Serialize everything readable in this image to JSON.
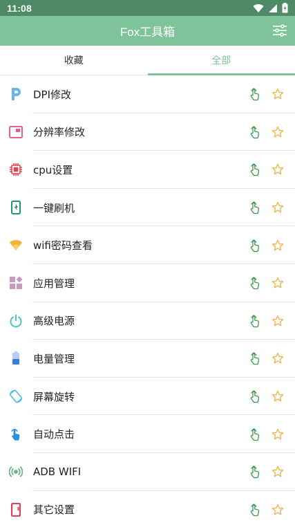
{
  "status_bar": {
    "time": "11:08"
  },
  "app_bar": {
    "title": "Fox工具箱"
  },
  "tabs": [
    {
      "label": "收藏",
      "active": false
    },
    {
      "label": "全部",
      "active": true
    }
  ],
  "colors": {
    "accent": "#7fc39a",
    "status_bar": "#4e8a66",
    "touch_icon": "#3b9a4c",
    "star_icon": "#f0b54a"
  },
  "items": [
    {
      "label": "DPI修改",
      "icon": "dpi-p-icon"
    },
    {
      "label": "分辨率修改",
      "icon": "resolution-icon"
    },
    {
      "label": "cpu设置",
      "icon": "cpu-chip-icon"
    },
    {
      "label": "一键刷机",
      "icon": "phone-flash-icon"
    },
    {
      "label": "wifi密码查看",
      "icon": "wifi-icon"
    },
    {
      "label": "应用管理",
      "icon": "apps-grid-icon"
    },
    {
      "label": "高级电源",
      "icon": "power-icon"
    },
    {
      "label": "电量管理",
      "icon": "battery-icon"
    },
    {
      "label": "屏幕旋转",
      "icon": "screen-rotation-icon"
    },
    {
      "label": "自动点击",
      "icon": "auto-tap-icon"
    },
    {
      "label": "ADB WIFI",
      "icon": "adb-wifi-icon"
    },
    {
      "label": "其它设置",
      "icon": "other-settings-icon"
    }
  ]
}
